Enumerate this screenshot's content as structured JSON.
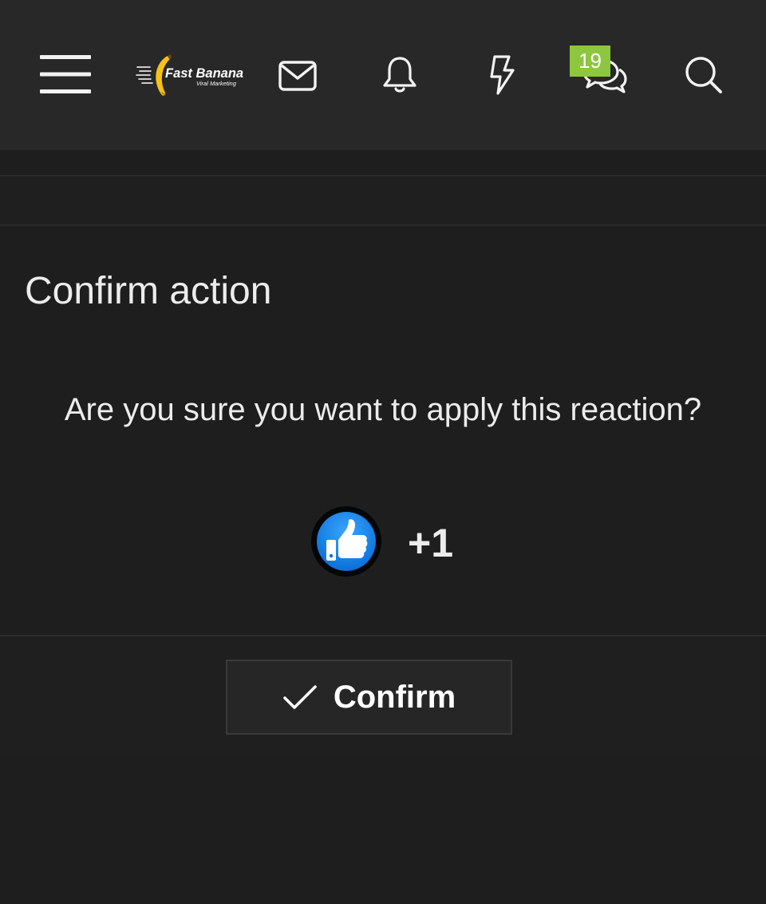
{
  "header": {
    "menu_icon": "hamburger-menu-icon",
    "logo": {
      "name": "Fast Banana",
      "tagline": "Viral Marketing"
    },
    "icons": [
      "envelope-icon",
      "bell-icon",
      "lightning-icon",
      "chat-bubbles-icon",
      "search-icon"
    ],
    "conversations_badge": "19",
    "badge_color": "#8dc63f"
  },
  "dialog": {
    "title": "Confirm action",
    "message": "Are you sure you want to apply this reaction?",
    "reaction": {
      "icon": "thumbs-up-icon",
      "label": "+1",
      "color": "#1e88e5"
    },
    "confirm_button": {
      "icon": "checkmark-icon",
      "label": "Confirm"
    }
  },
  "colors": {
    "background": "#1e1e1f",
    "header_background": "#282829",
    "text": "#ececec"
  }
}
